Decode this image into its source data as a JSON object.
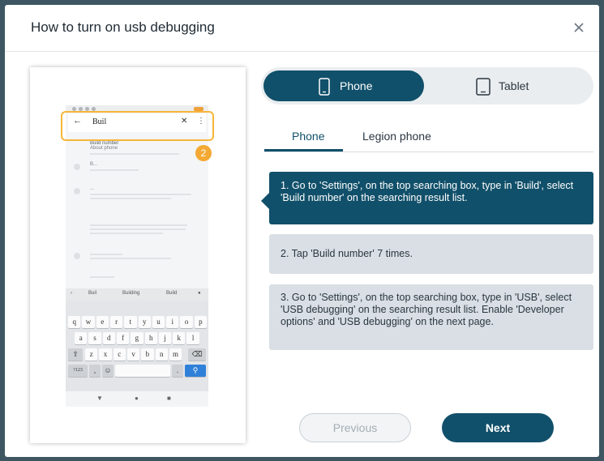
{
  "dialog": {
    "title": "How to turn on usb debugging",
    "close_icon": "close-icon"
  },
  "phone_preview": {
    "search_query": "Buil",
    "results": [
      {
        "title": "Build number",
        "subtitle": "About phone"
      },
      {
        "title": "B..."
      },
      {
        "title": "..."
      }
    ],
    "suggestions": [
      "Buil",
      "Building",
      "Build"
    ],
    "keyboard_rows": [
      [
        "q",
        "w",
        "e",
        "r",
        "t",
        "y",
        "u",
        "i",
        "o",
        "p"
      ],
      [
        "a",
        "s",
        "d",
        "f",
        "g",
        "h",
        "j",
        "k",
        "l"
      ],
      [
        "z",
        "x",
        "c",
        "v",
        "b",
        "n",
        "m"
      ]
    ],
    "keyboard_fn": {
      "symbols": "?123",
      "comma": ",",
      "period": "."
    },
    "highlight_step": "2"
  },
  "device_toggle": {
    "phone_label": "Phone",
    "tablet_label": "Tablet",
    "selected": "Phone"
  },
  "tabs": [
    {
      "label": "Phone",
      "active": true
    },
    {
      "label": "Legion phone",
      "active": false
    }
  ],
  "steps": [
    {
      "text": "1. Go to 'Settings', on the top searching box, type in 'Build', select 'Build number' on the searching result list.",
      "active": true
    },
    {
      "text": "2. Tap 'Build number' 7 times.",
      "active": false
    },
    {
      "text": "3. Go to 'Settings', on the top searching box, type in 'USB', select 'USB debugging' on the searching result list. Enable 'Developer options' and 'USB debugging' on the next page.",
      "active": false
    }
  ],
  "nav_buttons": {
    "previous_label": "Previous",
    "next_label": "Next"
  },
  "colors": {
    "accent": "#11506a",
    "highlight": "#f3a933",
    "inactive_step": "#d9dfe4"
  }
}
